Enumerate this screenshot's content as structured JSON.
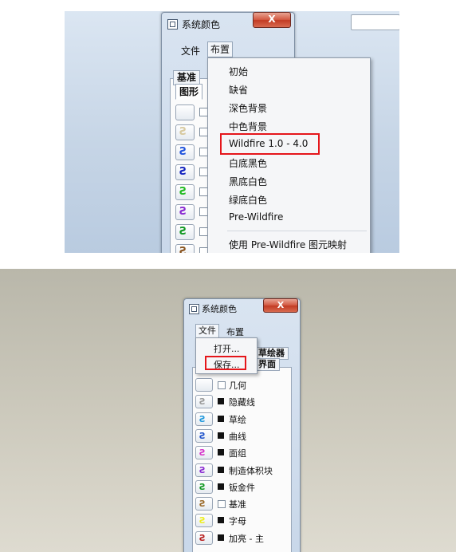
{
  "top": {
    "window_title": "系统颜色",
    "close_label": "X",
    "menu": {
      "file": "文件",
      "layout": "布置"
    },
    "tabs": {
      "datum": "基准",
      "graphics": "图形"
    },
    "dropdown": {
      "items": [
        "初始",
        "缺省",
        "深色背景",
        "中色背景",
        "Wildfire 1.0 - 4.0",
        "白底黑色",
        "黑底白色",
        "绿底白色",
        "Pre-Wildfire"
      ],
      "highlighted": "Wildfire 1.0 - 4.0",
      "footer": "使用 Pre-Wildfire 图元映射"
    },
    "swatch_colors": [
      "#ffffff",
      "#d7c9a0",
      "#2255dd",
      "#1525c0",
      "#22bb22",
      "#8a2bd2",
      "#119922",
      "#8a5520"
    ]
  },
  "bottom": {
    "window_title": "系统颜色",
    "close_label": "X",
    "menu": {
      "file": "文件",
      "layout": "布置"
    },
    "file_menu": {
      "open": "打开...",
      "save": "保存...",
      "highlighted": "保存..."
    },
    "tabs": {
      "sketcher": "草绘器",
      "ui": "用户界面"
    },
    "tab_visible_fragments": {
      "sketcher": "草绘器",
      "ui": "界面"
    },
    "rows": [
      {
        "label": "几何",
        "color": "#ffffff",
        "checked": false
      },
      {
        "label": "隐藏线",
        "color": "#9a9a9a",
        "checked": true
      },
      {
        "label": "草绘",
        "color": "#2299dd",
        "checked": true
      },
      {
        "label": "曲线",
        "color": "#2255cc",
        "checked": true
      },
      {
        "label": "面组",
        "color": "#d633c9",
        "checked": true
      },
      {
        "label": "制造体积块",
        "color": "#8a2bd2",
        "checked": true
      },
      {
        "label": "钣金件",
        "color": "#119922",
        "checked": true
      },
      {
        "label": "基准",
        "color": "#9a6a2a",
        "checked": false
      },
      {
        "label": "字母",
        "color": "#eeee22",
        "checked": true
      },
      {
        "label": "加亮 - 主",
        "color": "#b82020",
        "checked": true
      }
    ]
  }
}
